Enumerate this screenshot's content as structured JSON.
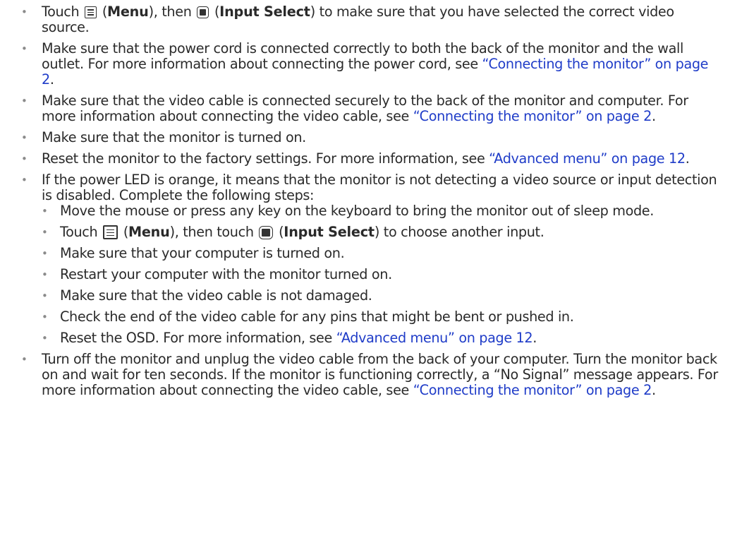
{
  "items": [
    {
      "touch": "Touch",
      "menu": "Menu",
      "then": "then",
      "input_select": "Input Select",
      "rest": "to make sure that you have selected the correct video source."
    },
    {
      "text": "Make sure that the power cord is connected correctly to both the back of the monitor and the wall outlet. For more information about connecting the power cord, see",
      "link": "“Connecting the monitor” on page 2"
    },
    {
      "text": "Make sure that the video cable is connected securely to the back of the monitor and computer. For more information about connecting the video cable, see",
      "link": "“Connecting the monitor” on page 2"
    },
    {
      "text": "Make sure that the monitor is turned on."
    },
    {
      "text": "Reset the monitor to the factory settings. For more information, see",
      "link": "“Advanced menu” on page 12"
    },
    {
      "text": "If the power LED is orange, it means that the monitor is not detecting a video source or input detection is disabled. Complete the following steps:",
      "sub": [
        {
          "text": "Move the mouse or press any key on the keyboard to bring the monitor out of sleep mode."
        },
        {
          "touch": "Touch",
          "menu": "Menu",
          "then": "then touch",
          "input_select": "Input Select",
          "rest": "to choose another input."
        },
        {
          "text": "Make sure that your computer is turned on."
        },
        {
          "text": "Restart your computer with the monitor turned on."
        },
        {
          "text": "Make sure that the video cable is not damaged."
        },
        {
          "text": "Check the end of the video cable for any pins that might be bent or pushed in."
        },
        {
          "text": "Reset the OSD. For more information, see",
          "link": "“Advanced menu” on page 12"
        }
      ]
    },
    {
      "text": "Turn off the monitor and unplug the video cable from the back of your computer. Turn the monitor back on and wait for ten seconds. If the monitor is functioning correctly, a “No Signal” message appears. For more information about connecting the video cable, see",
      "link": "“Connecting the monitor” on page 2"
    }
  ],
  "icons": {
    "menu": "menu-icon",
    "input_select": "input-select-icon"
  },
  "colors": {
    "text": "#2a2a2a",
    "link": "#1f3cc8",
    "bullet": "#8a8a8a"
  }
}
